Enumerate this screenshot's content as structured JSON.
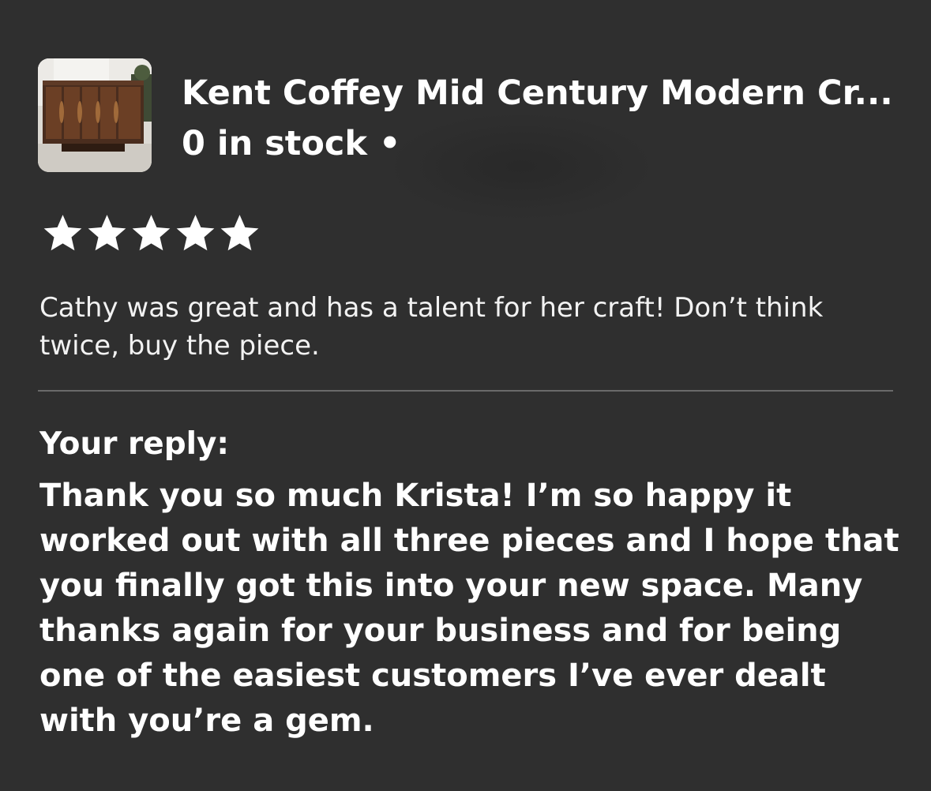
{
  "product": {
    "title": "Kent Coffey Mid Century Modern Cr...",
    "stock": "0 in stock •",
    "thumbnail_icon": "sideboard-photo"
  },
  "review": {
    "rating": 5,
    "rating_max": 5,
    "star_color": "#ffffff",
    "text": "Cathy was great and has a talent for her craft! Don’t think twice, buy the piece."
  },
  "reply": {
    "label": "Your reply:",
    "text": "Thank you so much Krista! I’m so happy it worked out with all three pieces and I hope that you finally got this into your new space. Many thanks again for your business and for being one of the easiest customers I’ve ever dealt with you’re a gem."
  },
  "colors": {
    "background": "#2f2f2f",
    "text": "#ffffff",
    "divider": "#6a6a6a"
  }
}
